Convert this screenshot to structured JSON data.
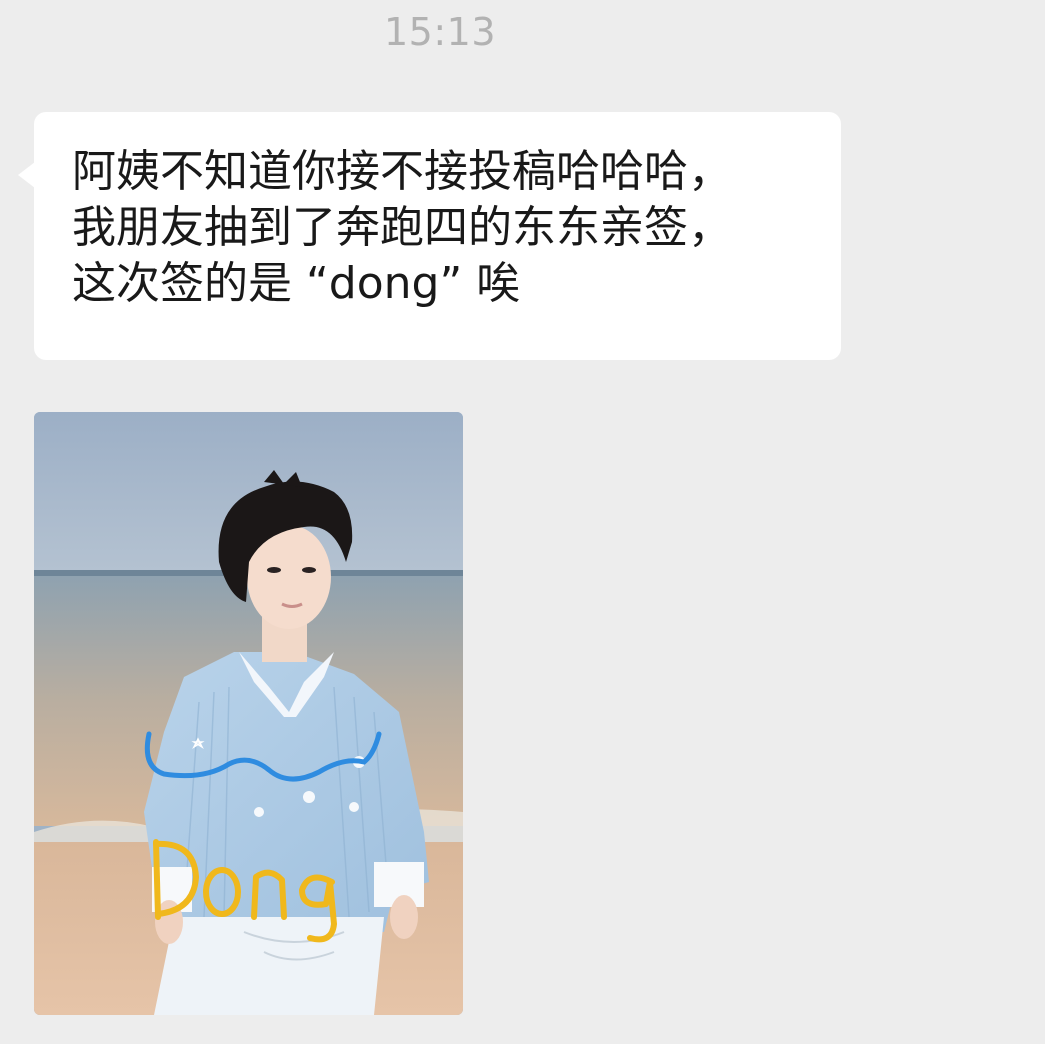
{
  "chat": {
    "timestamp": "15:13",
    "messages": [
      {
        "type": "text",
        "text": "阿姨不知道你接不接投稿哈哈哈，\n我朋友抽到了奔跑四的东东亲签，\n这次签的是 “dong” 唉"
      },
      {
        "type": "image",
        "description_icon": "photo-card-image",
        "signature_text": "Dong"
      }
    ]
  }
}
